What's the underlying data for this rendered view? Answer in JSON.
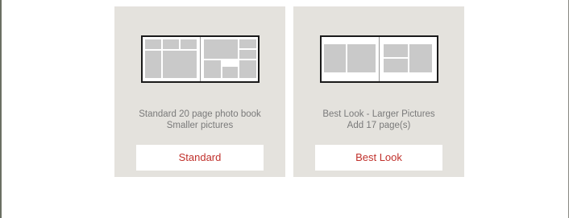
{
  "options": [
    {
      "description_line1": "Standard 20 page photo book",
      "description_line2": "Smaller pictures",
      "button_label": "Standard"
    },
    {
      "description_line1": "Best Look - Larger Pictures",
      "description_line2": "Add 17 page(s)",
      "button_label": "Best Look"
    }
  ],
  "colors": {
    "card_background": "#e4e2dd",
    "button_text": "#c0302b",
    "description_text": "#7a7a7a",
    "photo_placeholder": "#c9c9c9"
  }
}
